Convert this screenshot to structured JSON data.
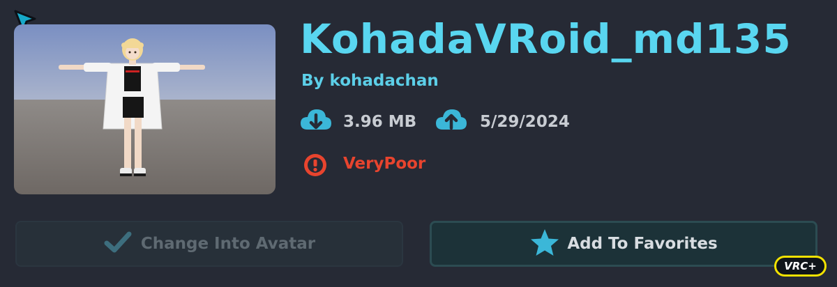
{
  "avatar": {
    "name": "KohadaVRoid_md135",
    "author": "By kohadachan",
    "file_size": "3.96 MB",
    "upload_date": "5/29/2024",
    "performance": "VeryPoor"
  },
  "icons": {
    "cursor": "cursor-arrow-icon",
    "size": "cloud-download-icon",
    "date": "cloud-upload-icon",
    "performance": "alert-circle-icon",
    "change": "checkmark-icon",
    "favorite": "star-icon"
  },
  "actions": {
    "change_label": "Change Into Avatar",
    "change_enabled": false,
    "favorite_label": "Add To Favorites"
  },
  "badge": {
    "label": "VRC+"
  },
  "colors": {
    "title": "#59d6f0",
    "accent": "#42b8d4",
    "performance_poor": "#e8442e",
    "badge_border": "#f2e200",
    "background": "#262a35"
  }
}
